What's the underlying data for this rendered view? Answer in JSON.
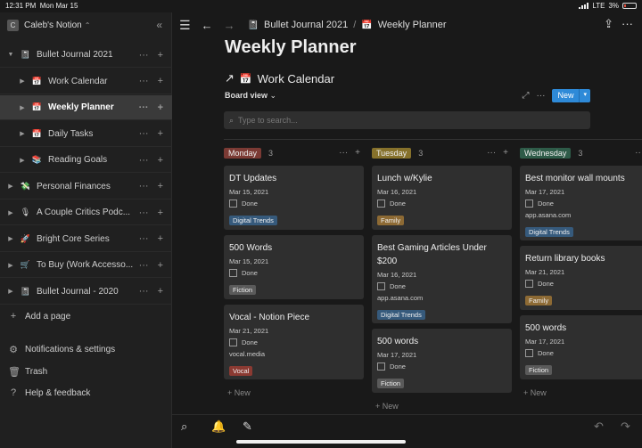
{
  "status_bar": {
    "time": "12:31 PM",
    "date": "Mon Mar 15",
    "network": "LTE",
    "battery": "3%"
  },
  "workspace": {
    "initial": "C",
    "name": "Caleb's Notion"
  },
  "sidebar": {
    "items": [
      {
        "label": "Bullet Journal 2021",
        "icon": "notebook-icon",
        "level": 0,
        "expanded": true
      },
      {
        "label": "Work Calendar",
        "icon": "calendar-icon",
        "level": 1
      },
      {
        "label": "Weekly Planner",
        "icon": "calendar-icon",
        "level": 1,
        "active": true
      },
      {
        "label": "Daily Tasks",
        "icon": "calendar-icon",
        "level": 1
      },
      {
        "label": "Reading Goals",
        "icon": "books-icon",
        "level": 1
      },
      {
        "label": "Personal Finances",
        "icon": "money-icon",
        "level": 0
      },
      {
        "label": "A Couple Critics Podc...",
        "icon": "microphone-icon",
        "level": 0
      },
      {
        "label": "Bright Core Series",
        "icon": "rocket-icon",
        "level": 0
      },
      {
        "label": "To Buy (Work Accesso...",
        "icon": "cart-icon",
        "level": 0
      },
      {
        "label": "Bullet Journal - 2020",
        "icon": "notebook-icon",
        "level": 0
      }
    ],
    "add_page": "Add a page",
    "footer": [
      {
        "label": "Notifications & settings",
        "icon": "gear-icon"
      },
      {
        "label": "Trash",
        "icon": "trash-icon"
      },
      {
        "label": "Help & feedback",
        "icon": "help-icon"
      }
    ]
  },
  "breadcrumb": [
    "Bullet Journal 2021",
    "Weekly Planner"
  ],
  "page": {
    "title": "Weekly Planner",
    "database_title": "Work Calendar",
    "view": "Board view",
    "new_label": "New",
    "search_placeholder": "Type to search..."
  },
  "board": {
    "add_new_label": "New",
    "done_label": "Done",
    "columns": [
      {
        "name": "Monday",
        "count": "3",
        "color": "#7b3a34",
        "cards": [
          {
            "title": "DT Updates",
            "date": "Mar 15, 2021",
            "url": "",
            "tag": "Digital Trends",
            "tag_color": "#365a7c"
          },
          {
            "title": "500 Words",
            "date": "Mar 15, 2021",
            "url": "",
            "tag": "Fiction",
            "tag_color": "#5a5a5a"
          },
          {
            "title": "Vocal - Notion Piece",
            "date": "Mar 21, 2021",
            "url": "vocal.media",
            "tag": "Vocal",
            "tag_color": "#8b3a32"
          }
        ]
      },
      {
        "name": "Tuesday",
        "count": "3",
        "color": "#86712b",
        "cards": [
          {
            "title": "Lunch w/Kylie",
            "date": "Mar 16, 2021",
            "url": "",
            "tag": "Family",
            "tag_color": "#8d6a34"
          },
          {
            "title": "Best Gaming Articles Under $200",
            "date": "Mar 16, 2021",
            "url": "app.asana.com",
            "tag": "Digital Trends",
            "tag_color": "#365a7c"
          },
          {
            "title": "500 words",
            "date": "Mar 17, 2021",
            "url": "",
            "tag": "Fiction",
            "tag_color": "#5a5a5a"
          }
        ]
      },
      {
        "name": "Wednesday",
        "count": "3",
        "color": "#2e5b48",
        "cards": [
          {
            "title": "Best monitor wall mounts",
            "date": "Mar 17, 2021",
            "url": "app.asana.com",
            "tag": "Digital Trends",
            "tag_color": "#365a7c"
          },
          {
            "title": "Return library books",
            "date": "Mar 21, 2021",
            "url": "",
            "tag": "Family",
            "tag_color": "#8d6a34"
          },
          {
            "title": "500 words",
            "date": "Mar 17, 2021",
            "url": "",
            "tag": "Fiction",
            "tag_color": "#5a5a5a"
          }
        ]
      }
    ]
  }
}
